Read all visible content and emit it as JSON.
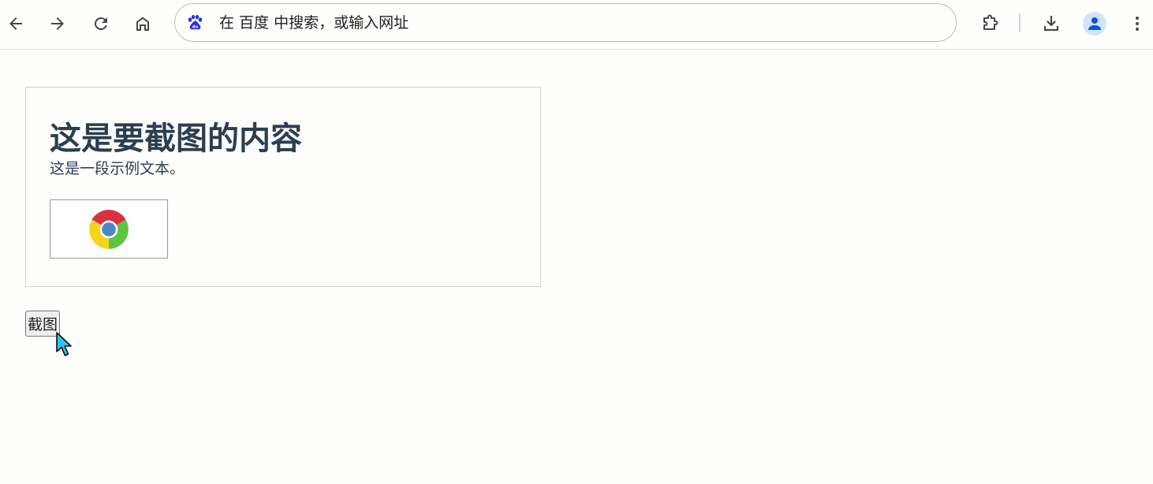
{
  "omnibox": {
    "placeholder": "在 百度 中搜索，或输入网址"
  },
  "icons": {
    "back": "back-arrow-icon",
    "forward": "forward-arrow-icon",
    "reload": "reload-icon",
    "home": "home-icon",
    "search_engine": "baidu-paw-icon",
    "extensions": "puzzle-piece-icon",
    "download": "download-icon",
    "profile": "person-icon",
    "menu": "three-dots-vertical-icon",
    "image": "chrome-logo-icon",
    "cursor": "mouse-pointer-icon"
  },
  "colors": {
    "heading_text": "#2c3e50",
    "baidu_blue": "#2932e1",
    "profile_blue": "#0b57d0",
    "cursor_cyan": "#2ec4f0"
  },
  "page": {
    "heading": "这是要截图的内容",
    "paragraph": "这是一段示例文本。",
    "capture_button_label": "截图"
  }
}
